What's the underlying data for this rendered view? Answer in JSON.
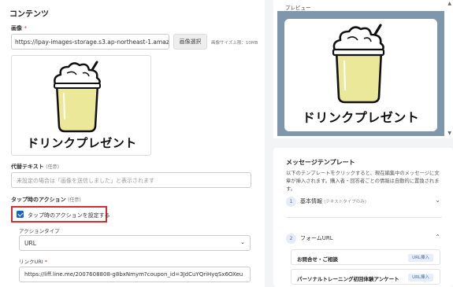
{
  "content": {
    "section_title": "コンテンツ",
    "image": {
      "label": "画像",
      "required_mark": "*",
      "url_value": "https://lpay-images-storage.s3.ap-northeast-1.amazc",
      "select_button": "画像選択",
      "size_note": "画像サイズ上限：10MB"
    },
    "image_caption": "ドリンクプレゼント",
    "alt_text": {
      "label": "代替テキスト",
      "optional": "(任意)",
      "placeholder": "未設定の場合は「画像を送信しました」と表示されます"
    },
    "tap_action": {
      "label": "タップ時のアクション",
      "optional": "(任意)",
      "checkbox_label": "タップ時のアクションを設定する",
      "checked": true,
      "action_type_label": "アクションタイプ",
      "action_type_value": "URL",
      "link_label": "リンクURI",
      "required_mark": "*",
      "link_value": "https://liff.line.me/2007608808-g8bxNmym?coupon_id=3JdCuYQriHyqSx6OXeu"
    }
  },
  "preview": {
    "label": "プレビュー",
    "caption": "ドリンクプレゼント",
    "frame_color": "#7f97ad"
  },
  "templates": {
    "title": "メッセージテンプレート",
    "description": "以下のテンプレートをクリックすると、現在編集中のメッセージに文章が挿入されます。購入者・回答者ごとの情報は自動的に置換されます。",
    "sections": [
      {
        "num": "1",
        "title": "基本情報",
        "sub": "(テキストタイプのみ)",
        "expanded": false
      },
      {
        "num": "2",
        "title": "フォームURL",
        "expanded": true
      }
    ],
    "items": [
      {
        "name": "お問合せ・ご相談",
        "tag": "URL挿入"
      },
      {
        "name": "パーソナルトレーニング初回体験アンケート",
        "tag": "URL挿入"
      }
    ]
  },
  "colors": {
    "accent": "#1565c0",
    "highlight": "#d32f2f",
    "juice": "#ece89a"
  }
}
